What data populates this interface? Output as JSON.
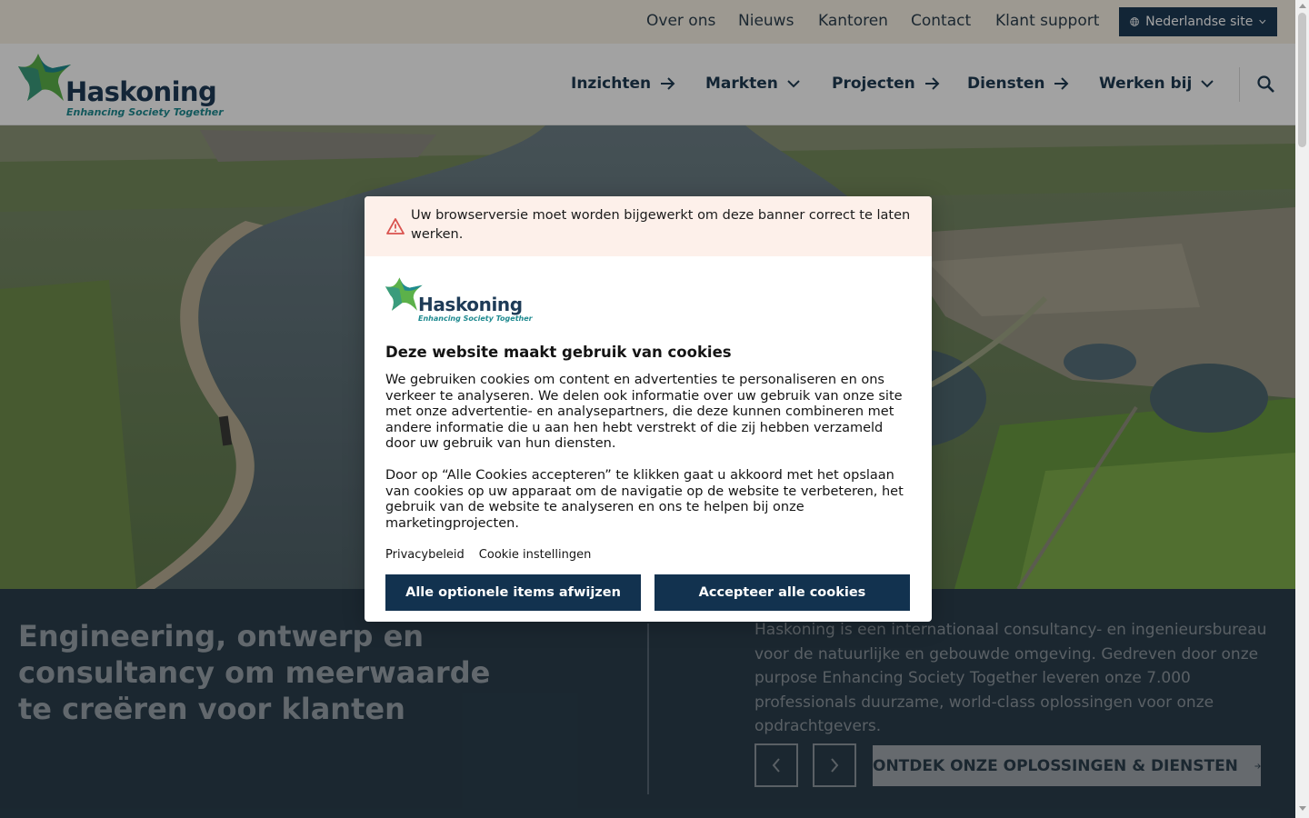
{
  "utility_nav": {
    "links": [
      "Over ons",
      "Nieuws",
      "Kantoren",
      "Contact",
      "Klant support"
    ],
    "site_switch": "Nederlandse site"
  },
  "header": {
    "logo_word": "Haskoning",
    "logo_tagline": "Enhancing Society Together",
    "nav": [
      {
        "label": "Inzichten",
        "icon": "arrow-right-icon"
      },
      {
        "label": "Markten",
        "icon": "chevron-down-icon"
      },
      {
        "label": "Projecten",
        "icon": "arrow-right-icon"
      },
      {
        "label": "Diensten",
        "icon": "arrow-right-icon"
      },
      {
        "label": "Werken bij",
        "icon": "chevron-down-icon"
      }
    ],
    "search_icon": "search-icon"
  },
  "hero": {
    "image": "aerial-river-landscape",
    "title": "Engineering, ontwerp en consultancy om meerwaarde te creëren voor klanten",
    "description": "Haskoning is een internationaal consultancy- en ingenieursbureau voor de natuurlijke en gebouwde omgeving. Gedreven door onze purpose Enhancing Society Together leveren onze 7.000 professionals duurzame, world-class oplossingen voor onze opdrachtgevers.",
    "cta": "ONTDEK ONZE OPLOSSINGEN & DIENSTEN"
  },
  "cookie_dialog": {
    "warning": "Uw browserversie moet worden bijgewerkt om deze banner correct te laten werken.",
    "logo_word": "Haskoning",
    "logo_tagline": "Enhancing Society Together",
    "title": "Deze website maakt gebruik van cookies",
    "paragraph_1": "We gebruiken cookies om content en advertenties te personaliseren en ons verkeer te analyseren. We delen ook informatie over uw gebruik van onze site met onze advertentie- en analysepartners, die deze kunnen combineren met andere informatie die u aan hen hebt verstrekt of die zij hebben verzameld door uw gebruik van hun diensten.",
    "paragraph_2": "Door op “Alle Cookies accepteren” te klikken gaat u akkoord met het opslaan van cookies op uw apparaat om de navigatie op de website te verbeteren, het gebruik van de website te analyseren en ons te helpen bij onze marketingprojecten.",
    "links": [
      "Privacybeleid",
      "Cookie instellingen"
    ],
    "reject_button": "Alle optionele items afwijzen",
    "accept_button": "Accepteer alle cookies"
  },
  "colors": {
    "brand_navy": "#1e3b57",
    "brand_teal": "#1f8a90",
    "brand_green": "#5cb14a",
    "button_navy": "#12324f",
    "panel_dark": "#2b3e4c",
    "warning_bg": "#fdf0ea",
    "warning_icon": "#d9534f"
  }
}
